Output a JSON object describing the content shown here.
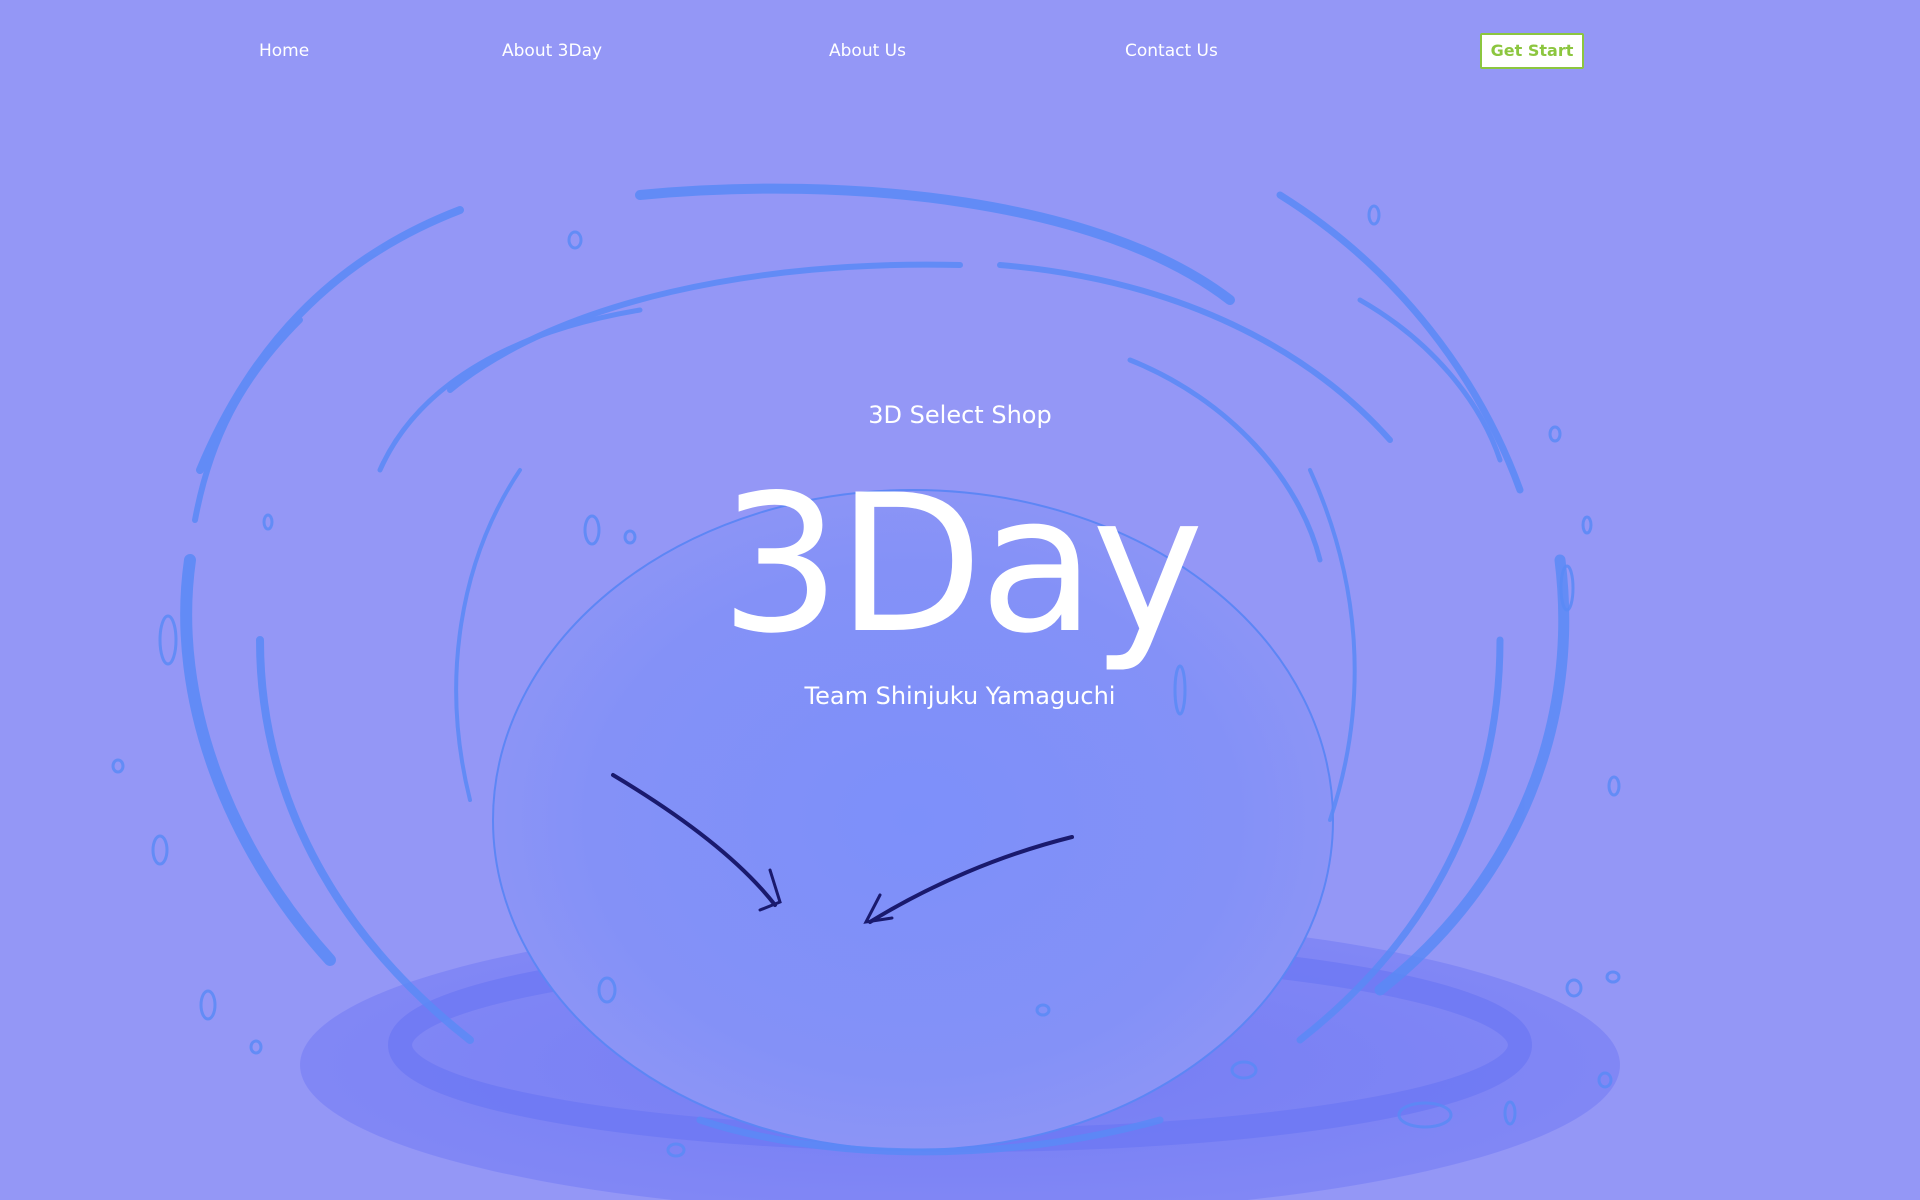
{
  "nav": {
    "items": [
      {
        "label": "Home"
      },
      {
        "label": "About 3Day"
      },
      {
        "label": "About Us"
      },
      {
        "label": "Contact Us"
      }
    ],
    "cta_label": "Get Start"
  },
  "hero": {
    "tagline": "3D Select Shop",
    "brand": "3Day",
    "team": "Team Shinjuku Yamaguchi"
  },
  "colors": {
    "background": "#9497f6",
    "accent": "#8cc63f",
    "water": "#4a7ef7",
    "eyes": "#1a1a6e"
  }
}
